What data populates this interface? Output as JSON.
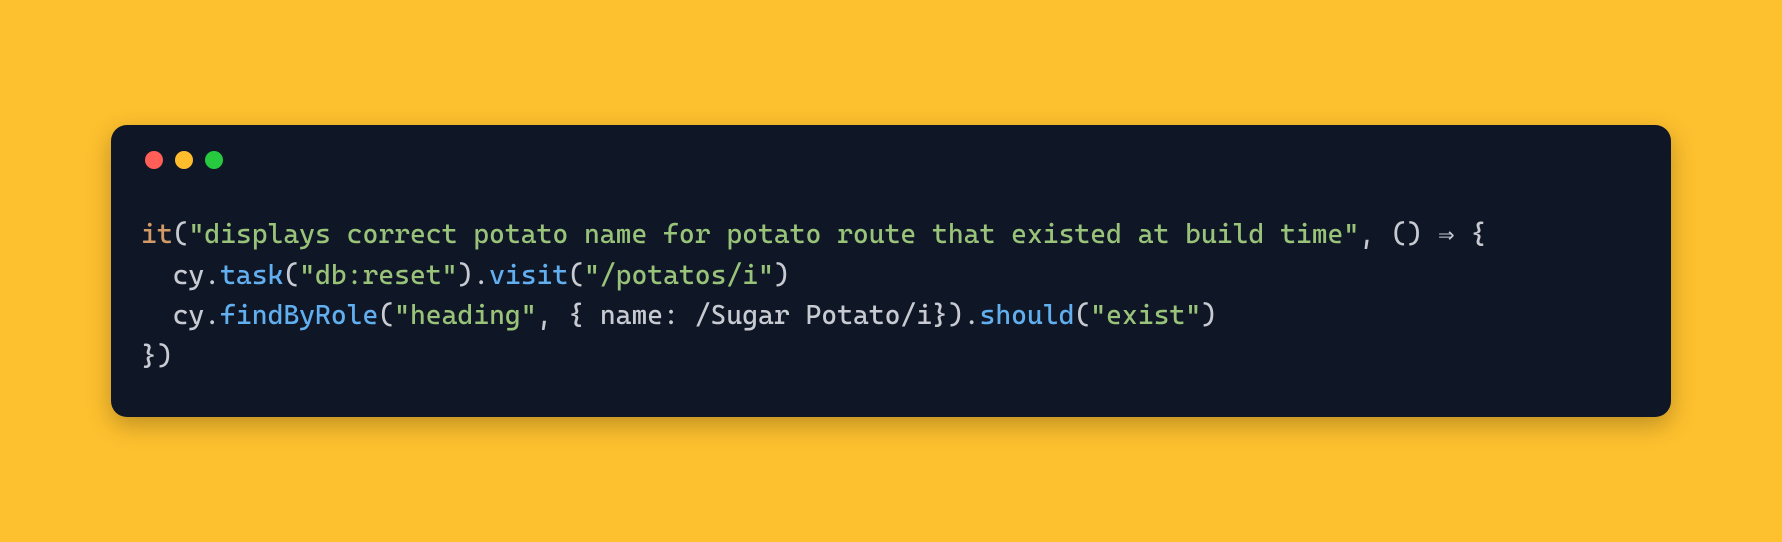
{
  "code": {
    "tokens": {
      "fn_it": "it",
      "str_testname": "\"displays correct potato name for potato route that existed at build time\"",
      "ident_cy1": "cy",
      "method_task": "task",
      "str_task_arg": "\"db:reset\"",
      "method_visit": "visit",
      "str_visit_arg": "\"/potatos/i\"",
      "ident_cy2": "cy",
      "method_findByRole": "findByRole",
      "str_role_arg": "\"heading\"",
      "prop_name": "name",
      "regex_val": "/Sugar Potato/i",
      "method_should": "should",
      "str_should_arg": "\"exist\""
    },
    "punc": {
      "open_paren": "(",
      "close_paren": ")",
      "comma_sp": ", ",
      "arrow": " ⇒ ",
      "open_brace": "{",
      "close_brace": "}",
      "open_obj": "{ ",
      "close_obj": "}",
      "colon_sp": ": ",
      "dot": ".",
      "close_call_brace": "})"
    },
    "indent": {
      "one": "  "
    }
  },
  "window": {
    "controls": [
      "close",
      "minimize",
      "zoom"
    ]
  }
}
